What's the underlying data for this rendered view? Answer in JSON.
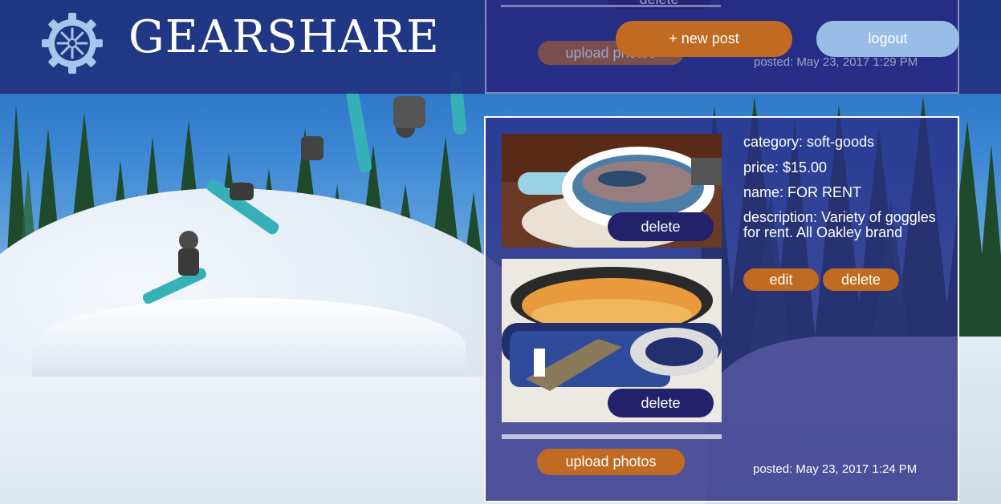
{
  "header": {
    "brand": "GEARSHARE",
    "logo_icon": "gear-snowflake-icon",
    "new_post_label": "+ new post",
    "logout_label": "logout"
  },
  "previous_post": {
    "photo_delete_label": "delete",
    "upload_label": "upload photos",
    "posted": "posted: May 23, 2017 1:29 PM"
  },
  "post": {
    "category": "category: soft-goods",
    "price": "price: $15.00",
    "name": "name: FOR RENT",
    "description": "description: Variety of goggles for rent. All Oakley brand",
    "edit_label": "edit",
    "delete_label": "delete",
    "photos": [
      {
        "delete_label": "delete"
      },
      {
        "delete_label": "delete"
      }
    ],
    "upload_label": "upload photos",
    "posted": "posted: May 23, 2017 1:24 PM"
  },
  "colors": {
    "header_bg": "#213480",
    "card_bg": "#282c84",
    "accent_orange": "#c06a22",
    "logout_blue": "#98bde6",
    "photo_delete_bg": "#23216a"
  }
}
